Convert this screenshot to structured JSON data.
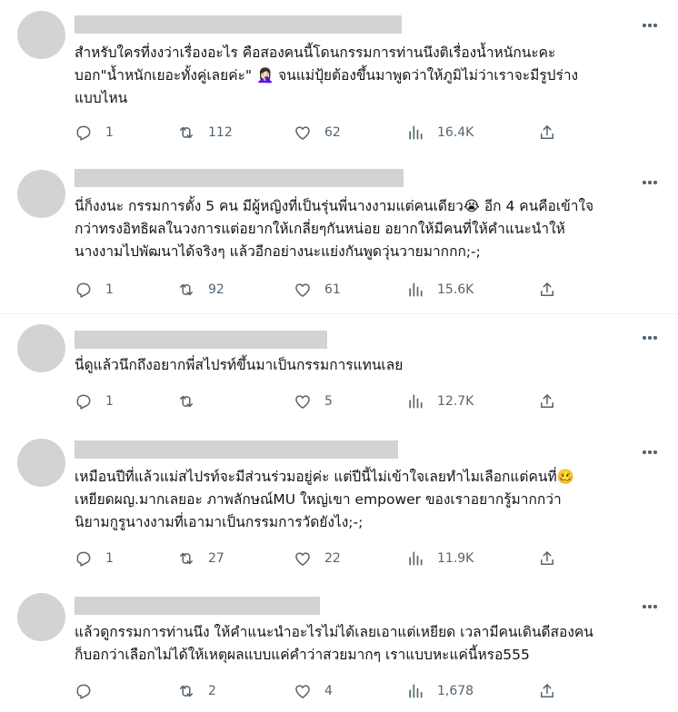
{
  "tweets": [
    {
      "text": "สำหรับใครที่งงว่าเรื่องอะไร คือสองคนนี้โดนกรรมการท่านนึงติเรื่องน้ำหนักนะคะ\nบอก\"น้ำหนักเยอะทั้งคู่เลยค่ะ\" 🤦🏻‍♀️ จนแม่ปุ้ยต้องขึ้นมาพูดว่าให้ภูมิไม่ว่าเราจะมีรูปร่าง\nแบบไหน",
      "replies": "1",
      "reposts": "112",
      "likes": "62",
      "views": "16.4K"
    },
    {
      "text": "นี่ก็งงนะ กรรมการตั้ง 5 คน มีผู้หญิงที่เป็นรุ่นพี่นางงามแต่คนเดียว😭 อีก 4 คนคือเข้าใจ\nกว่าทรงอิทธิผลในวงการแต่อยากให้เกลี่ยๆกันหน่อย อยากให้มีคนที่ให้คำแนะนำให้\nนางงามไปพัฒนาได้จริงๆ แล้วอีกอย่างนะแย่งกันพูดวุ่นวายมากกก;-;",
      "replies": "1",
      "reposts": "92",
      "likes": "61",
      "views": "15.6K"
    },
    {
      "text": "นี่ดูแล้วนึกถึงอยากพี่สไปรท์ขึ้นมาเป็นกรรมการแทนเลย",
      "replies": "1",
      "reposts": "",
      "likes": "5",
      "views": "12.7K"
    },
    {
      "text": "เหมือนปีที่แล้วแม่สไปรท์จะมีส่วนร่วมอยู่ค่ะ แต่ปีนี้ไม่เข้าใจเลยทำไมเลือกแต่คนที่🥴\nเหยียดผญ.มากเลยอะ ภาพลักษณ์MU ใหญ่เขา empower ของเราอยากรู้มากกว่า\nนิยามกูรูนางงามที่เอามาเป็นกรรมการวัดยังไง;-;",
      "replies": "1",
      "reposts": "27",
      "likes": "22",
      "views": "11.9K"
    },
    {
      "text": "แล้วดูกรรมการท่านนึง ให้คำแนะนำอะไรไม่ได้เลยเอาแต่เหยียด เวลามีคนเดินดีสองคน\nก็บอกว่าเลือกไม่ได้ให้เหตุผลแบบแค่คำว่าสวยมากๆ เราแบบหะแค่นี้หรอ555",
      "replies": "",
      "reposts": "2",
      "likes": "4",
      "views": "1,678"
    }
  ],
  "icons": {
    "reply": "reply-icon",
    "repost": "repost-icon",
    "like": "like-icon",
    "views": "views-icon",
    "share": "share-icon",
    "more": "more-icon"
  },
  "colors": {
    "text": "#0f1419",
    "secondary": "#536471",
    "placeholder": "#d3d3d3",
    "divider": "#eff3f4"
  }
}
